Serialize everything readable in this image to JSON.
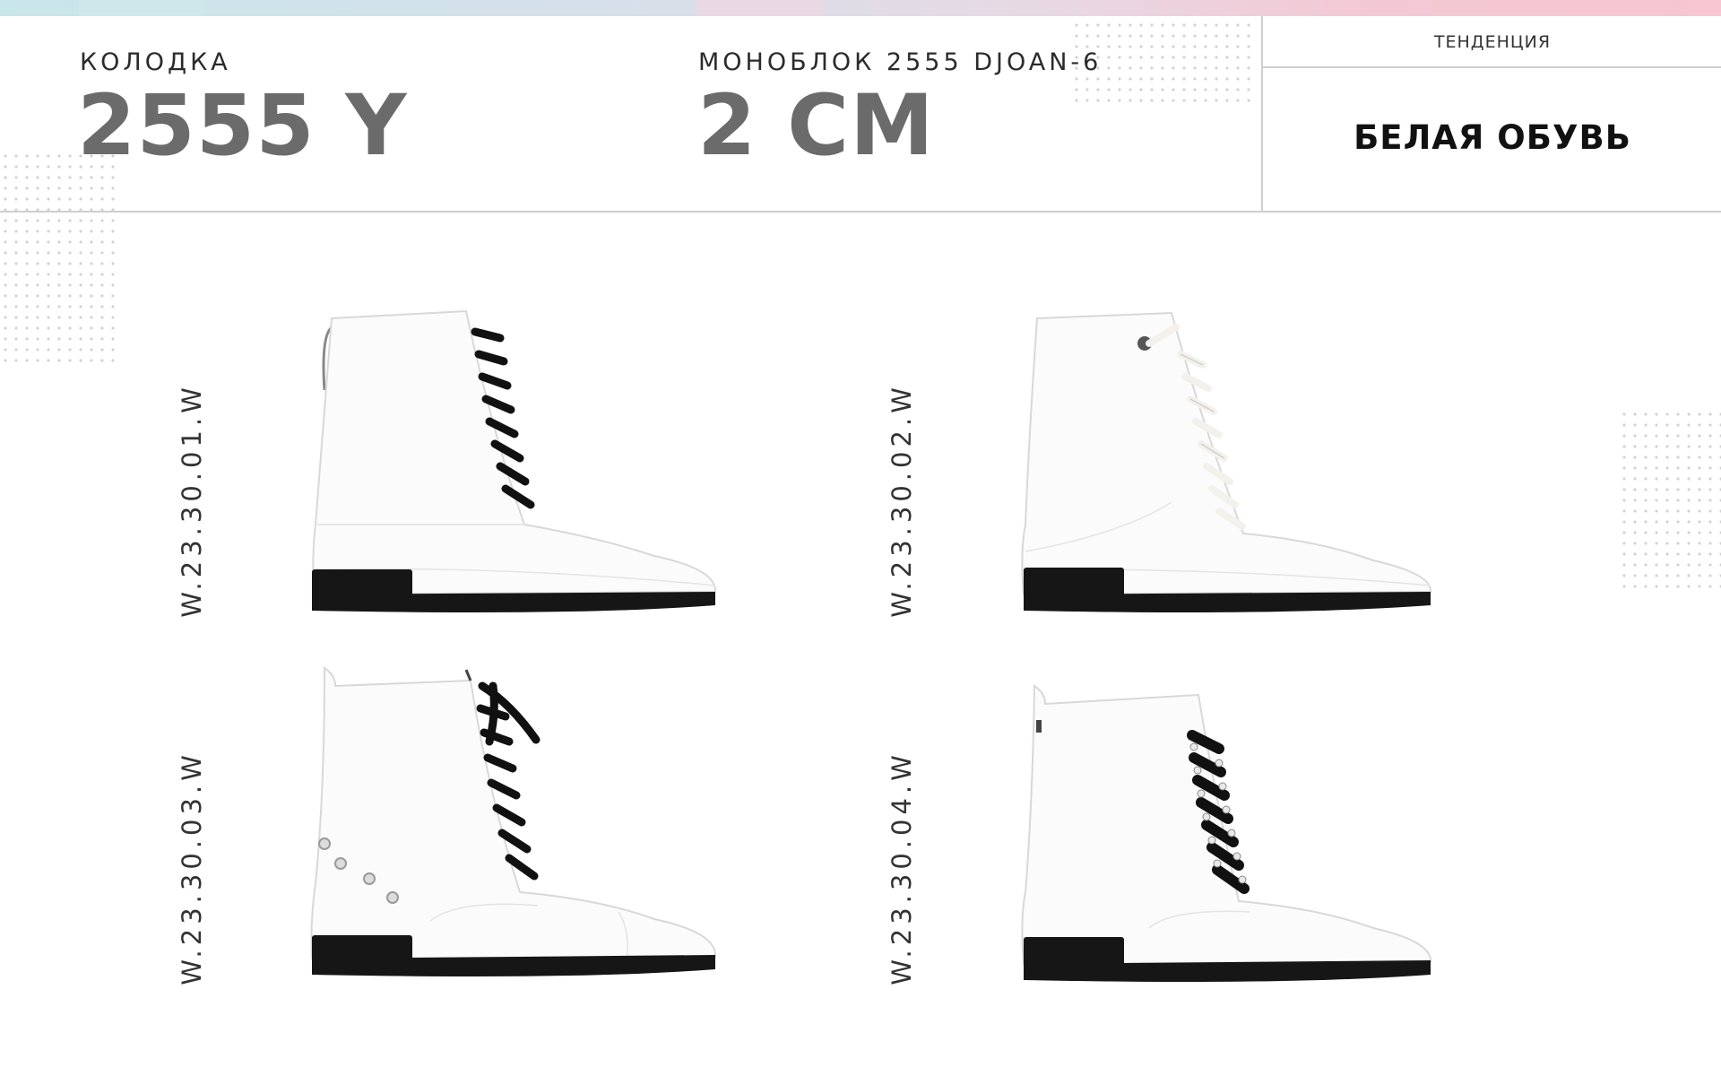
{
  "header": {
    "last_label": "КОЛОДКА",
    "last_value": "2555 Y",
    "sole_label": "МОНОБЛОК 2555 DJOAN-6",
    "sole_value": "2 CM",
    "trend_label": "ТЕНДЕНЦИЯ",
    "trend_value": "БЕЛАЯ ОБУВЬ"
  },
  "products": [
    {
      "code": "W.23.30.01.W",
      "lace_color": "#111111"
    },
    {
      "code": "W.23.30.02.W",
      "lace_color": "#f4f1ec"
    },
    {
      "code": "W.23.30.03.W",
      "lace_color": "#111111"
    },
    {
      "code": "W.23.30.04.W",
      "lace_color": "#111111"
    }
  ],
  "colors": {
    "boot_body": "#fbfbfb",
    "sole": "#161616",
    "value_text": "#6b6b6b"
  }
}
